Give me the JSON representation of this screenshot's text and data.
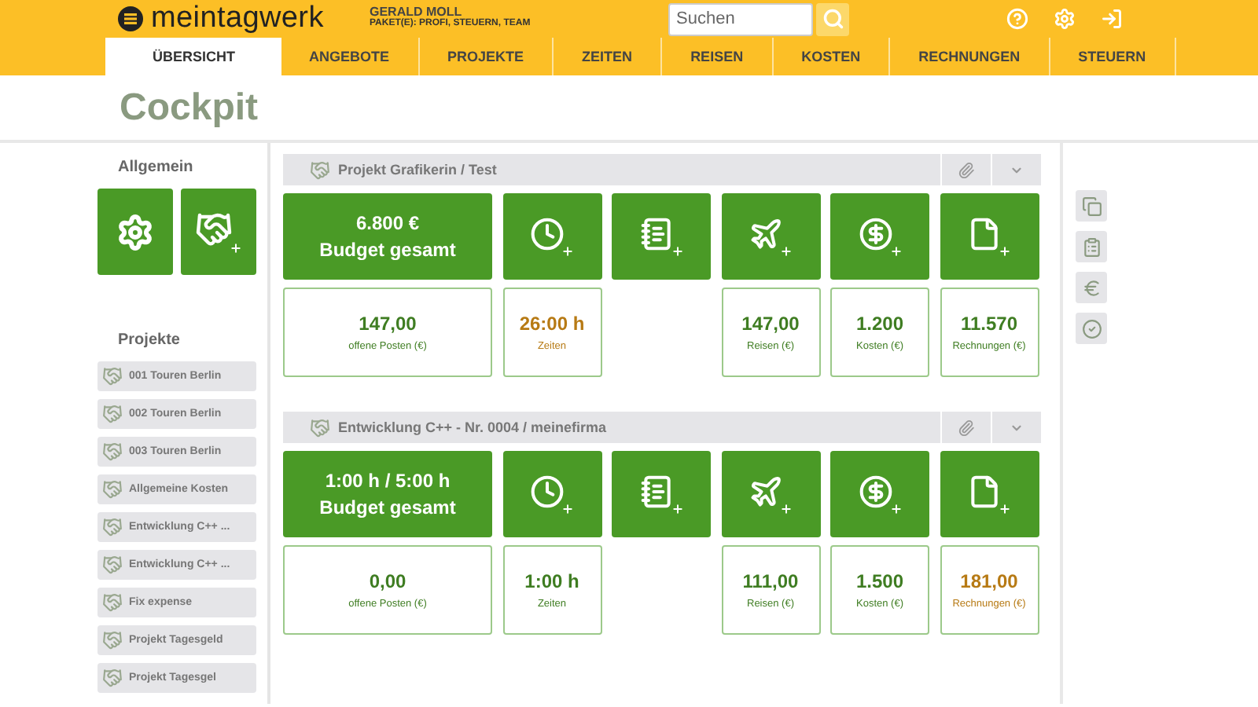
{
  "header": {
    "logo": "meintagwerk",
    "user": "GERALD MOLL",
    "package": "PAKET(E): PROFI, STEUERN, TEAM",
    "search": {
      "placeholder": "Suchen"
    }
  },
  "tabs": [
    {
      "label": "ÜBERSICHT",
      "selected": true
    },
    {
      "label": "ANGEBOTE",
      "selected": false
    },
    {
      "label": "PROJEKTE",
      "selected": false
    },
    {
      "label": "ZEITEN",
      "selected": false
    },
    {
      "label": "REISEN",
      "selected": false
    },
    {
      "label": "KOSTEN",
      "selected": false
    },
    {
      "label": "RECHNUNGEN",
      "selected": false
    },
    {
      "label": "STEUERN",
      "selected": false
    }
  ],
  "page_title": "Cockpit",
  "sidebar": {
    "general_title": "Allgemein",
    "projects_title": "Projekte",
    "projects": [
      "001 Touren Berlin",
      "002 Touren Berlin",
      "003 Touren Berlin",
      "Allgemeine Kosten",
      "Entwicklung C++ ...",
      "Entwicklung C++ ...",
      "Fix expense",
      "Projekt Tagesgeld",
      "Projekt Tagesgel"
    ]
  },
  "projects": [
    {
      "name": "Projekt Grafikerin / Test",
      "budget_value": "6.800 €",
      "budget_label": "Budget gesamt",
      "stats": [
        {
          "kind": "stat",
          "value": "147,00",
          "label": "offene Posten (€)",
          "warning": false
        },
        {
          "kind": "stat",
          "value": "26:00 h",
          "label": "Zeiten",
          "warning": true
        },
        {
          "kind": "blank"
        },
        {
          "kind": "stat",
          "value": "147,00",
          "label": "Reisen (€)",
          "warning": false
        },
        {
          "kind": "stat",
          "value": "1.200",
          "label": "Kosten (€)",
          "warning": false
        },
        {
          "kind": "stat",
          "value": "11.570",
          "label": "Rechnungen (€)",
          "warning": false
        }
      ]
    },
    {
      "name": "Entwicklung C++ - Nr. 0004 / meinefirma",
      "budget_value": "1:00 h / 5:00 h",
      "budget_label": "Budget gesamt",
      "stats": [
        {
          "kind": "stat",
          "value": "0,00",
          "label": "offene Posten (€)",
          "warning": false
        },
        {
          "kind": "stat",
          "value": "1:00 h",
          "label": "Zeiten",
          "warning": false
        },
        {
          "kind": "blank"
        },
        {
          "kind": "stat",
          "value": "111,00",
          "label": "Reisen (€)",
          "warning": false
        },
        {
          "kind": "stat",
          "value": "1.500",
          "label": "Kosten (€)",
          "warning": false
        },
        {
          "kind": "stat",
          "value": "181,00",
          "label": "Rechnungen (€)",
          "warning": true
        }
      ]
    }
  ]
}
